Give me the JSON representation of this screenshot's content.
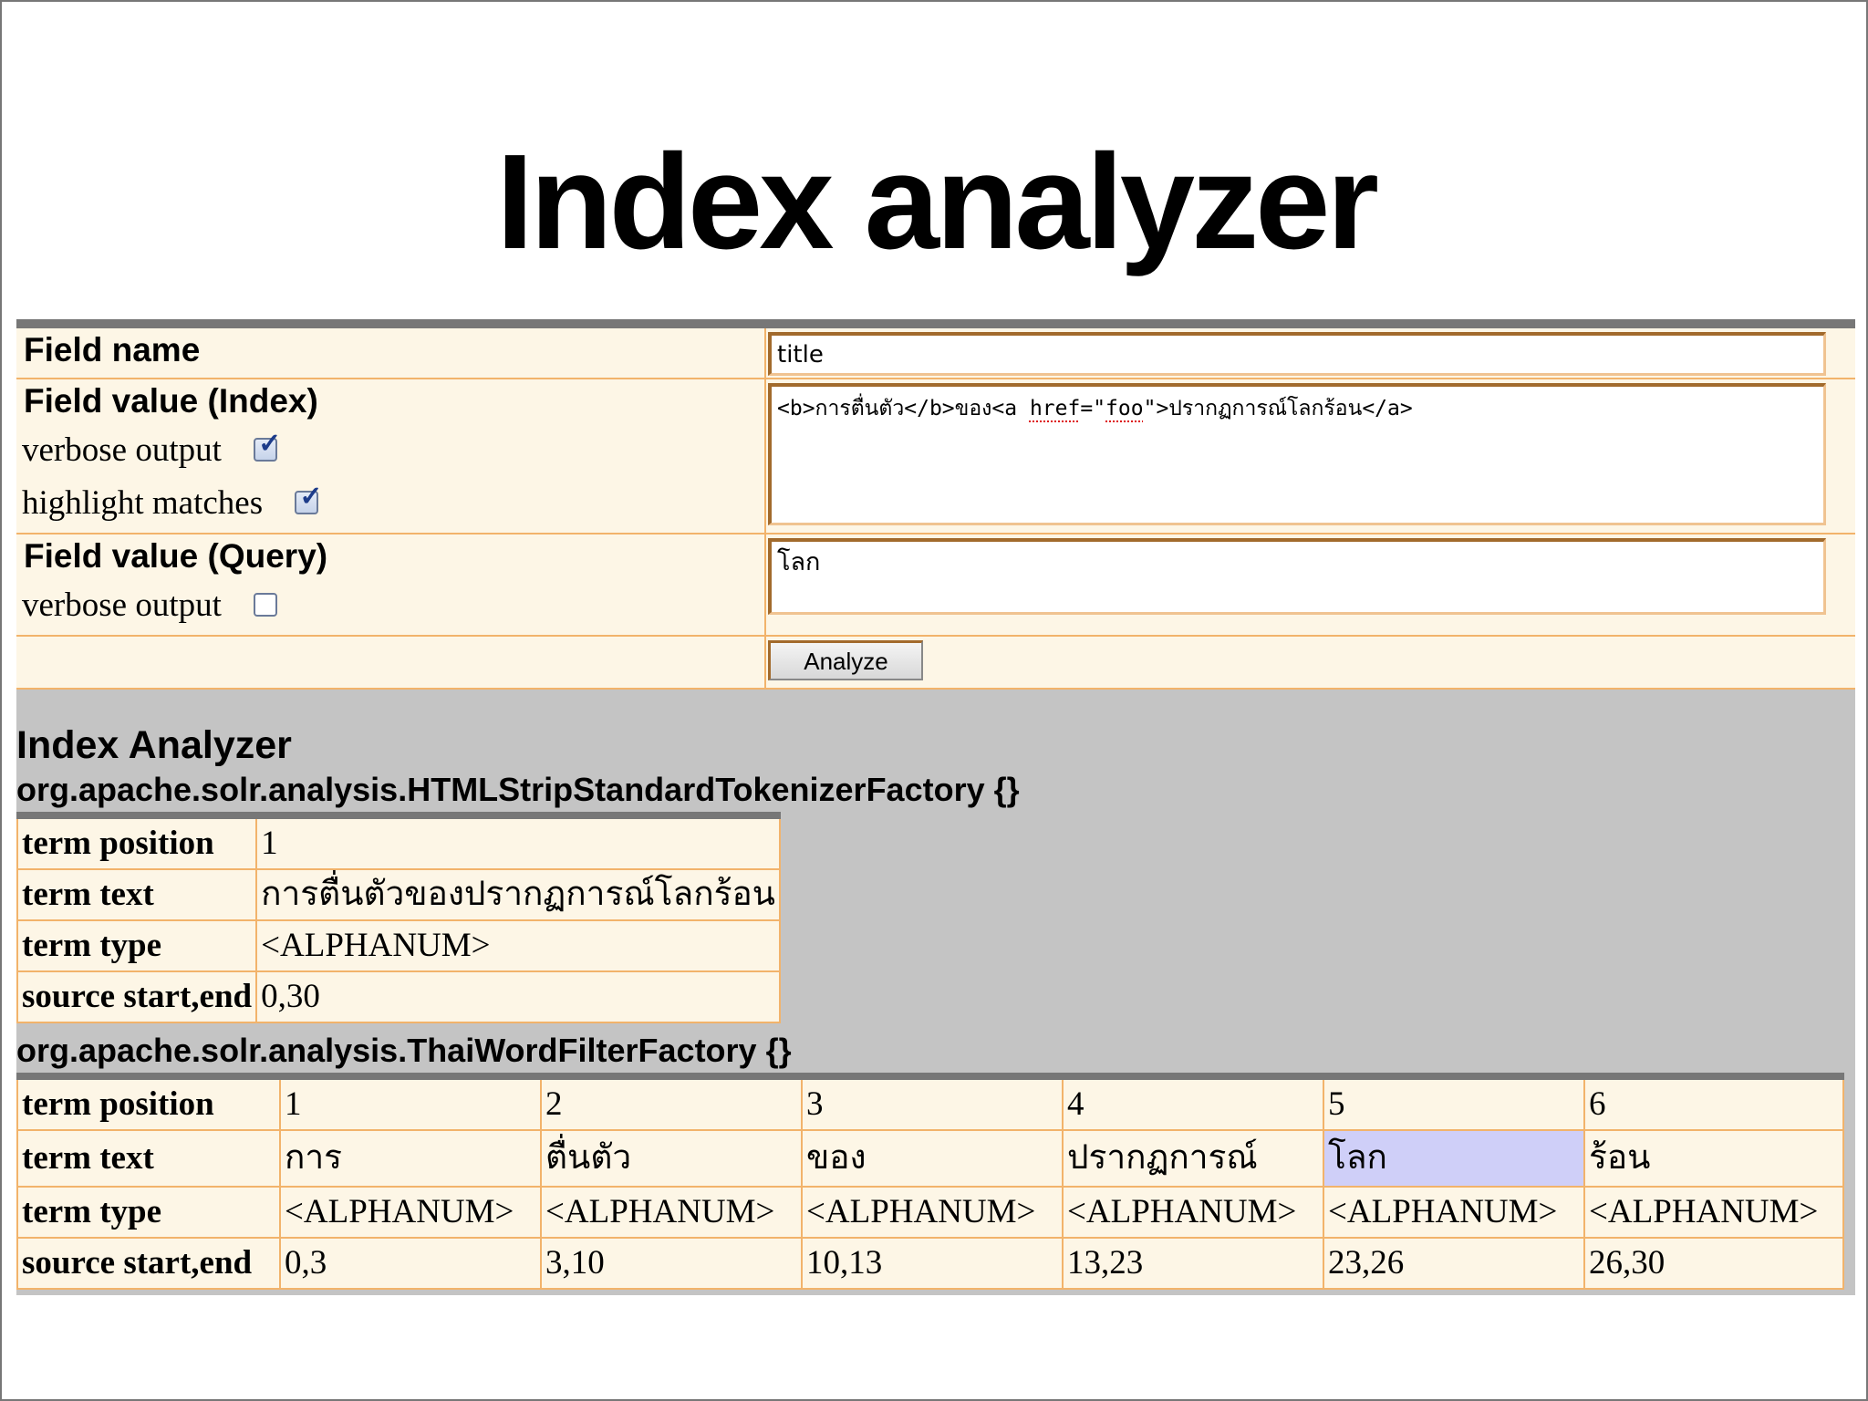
{
  "slide": {
    "title": "Index analyzer"
  },
  "form": {
    "field_name": {
      "label": "Field name",
      "value": "title"
    },
    "field_value_index": {
      "label": "Field value (Index)",
      "verbose_label": "verbose output",
      "verbose_checked": true,
      "highlight_label": "highlight matches",
      "highlight_checked": true,
      "value_parts": [
        "<b>การตื่นตัว</b>ของ<a ",
        "href",
        "=\"",
        "foo",
        "\">ปรากฏการณ์โลกร้อน</a>"
      ]
    },
    "field_value_query": {
      "label": "Field value (Query)",
      "verbose_label": "verbose output",
      "verbose_checked": false,
      "value": "โลก"
    },
    "analyze_button": "Analyze"
  },
  "analyzer": {
    "heading": "Index Analyzer",
    "tokenizer": {
      "name": "org.apache.solr.analysis.HTMLStripStandardTokenizerFactory {}",
      "row_labels": [
        "term position",
        "term text",
        "term type",
        "source start,end"
      ],
      "tokens": [
        {
          "position": "1",
          "text": "การตื่นตัวของปรากฏการณ์โลกร้อน",
          "type": "<ALPHANUM>",
          "offsets": "0,30"
        }
      ]
    },
    "filter": {
      "name": "org.apache.solr.analysis.ThaiWordFilterFactory {}",
      "row_labels": [
        "term position",
        "term text",
        "term type",
        "source start,end"
      ],
      "tokens": [
        {
          "position": "1",
          "text": "การ",
          "type": "<ALPHANUM>",
          "offsets": "0,3"
        },
        {
          "position": "2",
          "text": "ตื่นตัว",
          "type": "<ALPHANUM>",
          "offsets": "3,10"
        },
        {
          "position": "3",
          "text": "ของ",
          "type": "<ALPHANUM>",
          "offsets": "10,13"
        },
        {
          "position": "4",
          "text": "ปรากฏการณ์",
          "type": "<ALPHANUM>",
          "offsets": "13,23"
        },
        {
          "position": "5",
          "text": "โลก",
          "type": "<ALPHANUM>",
          "offsets": "23,26",
          "highlighted": true
        },
        {
          "position": "6",
          "text": "ร้อน",
          "type": "<ALPHANUM>",
          "offsets": "26,30"
        }
      ]
    },
    "highlight_color": "#cfcff8"
  }
}
